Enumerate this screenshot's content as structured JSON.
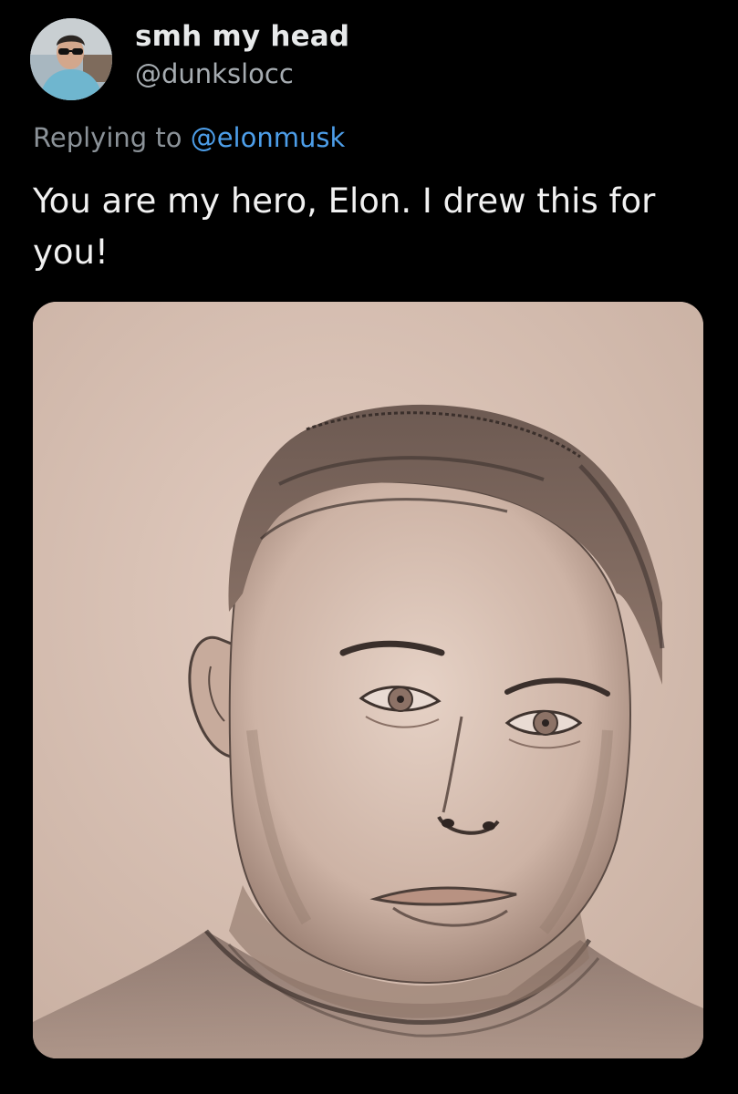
{
  "author": {
    "display_name": "smh my head",
    "handle": "@dunkslocc",
    "avatar_icon": "user-avatar"
  },
  "reply": {
    "prefix": "Replying to",
    "mention": "@elonmusk"
  },
  "tweet": {
    "text": "You are my hero, Elon. I drew this for you!"
  },
  "media": {
    "type": "pencil-sketch-portrait-image"
  },
  "colors": {
    "background": "#000000",
    "primary_text": "#e7e9ea",
    "secondary_text": "#8b9298",
    "mention_blue": "#4d9ee9",
    "paper": "#d9c3b6"
  }
}
